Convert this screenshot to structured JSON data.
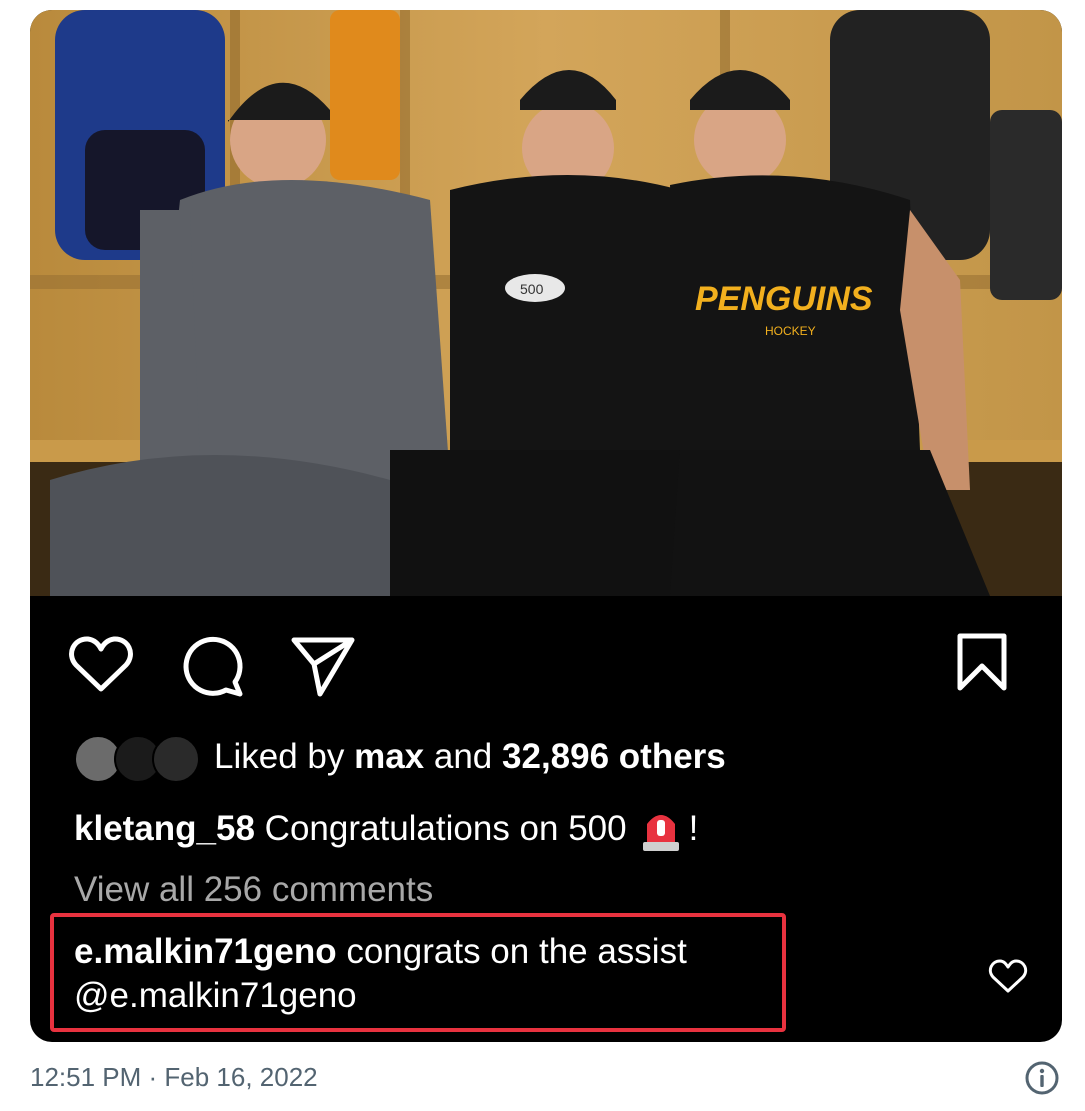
{
  "post": {
    "likes": {
      "prefix": "Liked by ",
      "user": "max",
      "connector": " and ",
      "count": "32,896 others"
    },
    "caption": {
      "username": "kletang_58",
      "text": "Congratulations on 500",
      "emoji": "siren-emoji",
      "suffix": "!"
    },
    "view_comments": "View all 256 comments",
    "highlighted_comment": {
      "username": "e.malkin71geno",
      "text": "congrats on the assist",
      "mention": "@e.malkin71geno"
    },
    "photo_jersey_text": "PENGUINS",
    "photo_jersey_subtext": "HOCKEY",
    "photo_puck_text": "500"
  },
  "tweet": {
    "timestamp": "12:51 PM · Feb 16, 2022"
  },
  "colors": {
    "highlight_border": "#e8323f",
    "card_bg": "#000000",
    "muted_text": "#a8a8a8",
    "footer_text": "#536471"
  },
  "icons": [
    "heart-icon",
    "comment-icon",
    "share-icon",
    "bookmark-icon",
    "info-icon"
  ]
}
